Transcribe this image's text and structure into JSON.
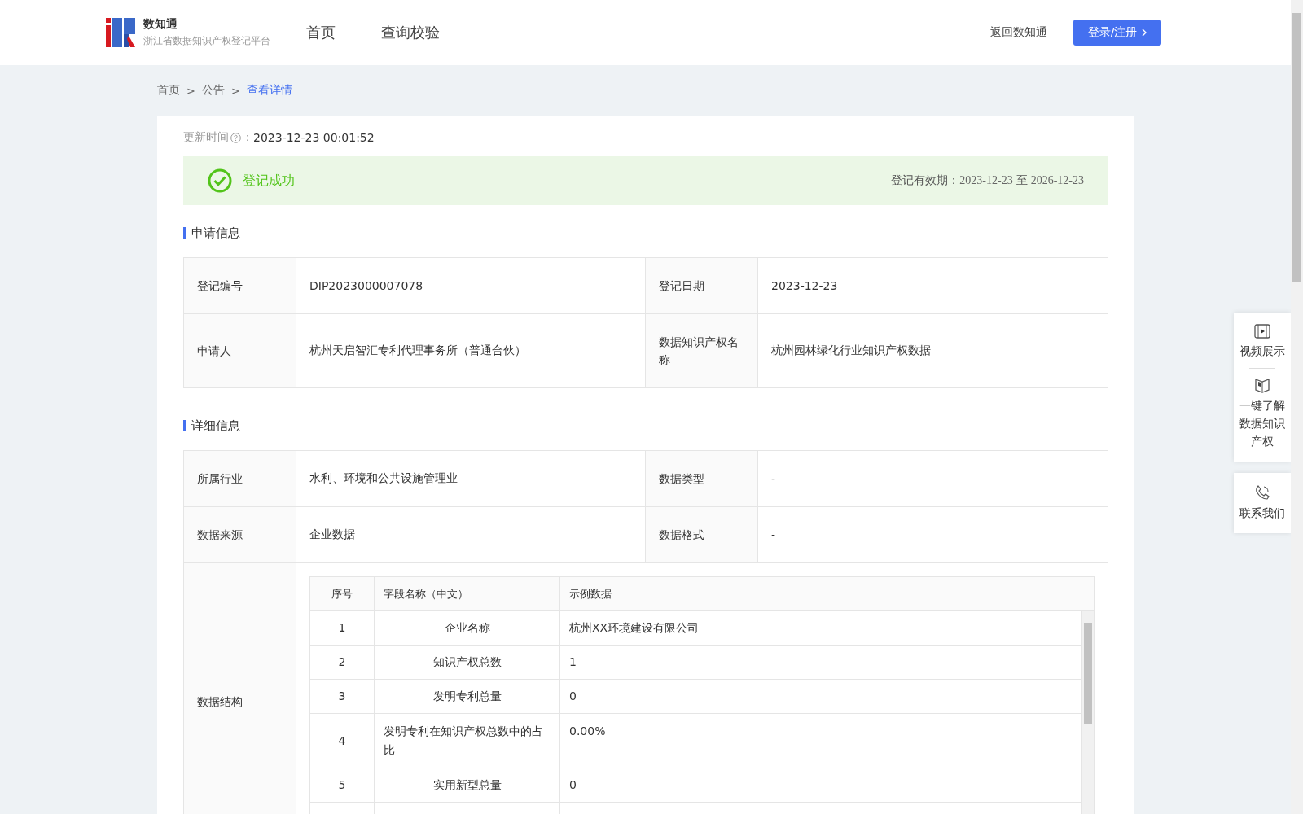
{
  "header": {
    "brand": "数知通",
    "subtitle": "浙江省数据知识产权登记平台",
    "nav": [
      {
        "label": "首页",
        "selected": false
      },
      {
        "label": "查询校验",
        "selected": false
      }
    ],
    "back_link": "返回数知通",
    "login_button": "登录/注册"
  },
  "breadcrumb": [
    {
      "label": "首页",
      "selected": false
    },
    {
      "label": "公告",
      "selected": false
    },
    {
      "label": "查看详情",
      "selected": true
    }
  ],
  "breadcrumb_separator": ">",
  "update": {
    "label": "更新时间",
    "separator": "：",
    "value": "2023-12-23 00:01:52"
  },
  "status": {
    "text": "登记成功",
    "validity_label": "登记有效期：",
    "start": "2023-12-23",
    "to": "至",
    "end": "2026-12-23"
  },
  "application": {
    "title": "申请信息",
    "rows": [
      {
        "label1": "登记编号",
        "value1": "DIP2023000007078",
        "label2": "登记日期",
        "value2": "2023-12-23"
      },
      {
        "label1": "申请人",
        "value1": "杭州天启智汇专利代理事务所（普通合伙）",
        "label2": "数据知识产权名称",
        "value2": "杭州园林绿化行业知识产权数据"
      }
    ]
  },
  "details": {
    "title": "详细信息",
    "rows": [
      {
        "label1": "所属行业",
        "value1": "水利、环境和公共设施管理业",
        "label2": "数据类型",
        "value2": "-"
      },
      {
        "label1": "数据来源",
        "value1": "企业数据",
        "label2": "数据格式",
        "value2": "-"
      }
    ],
    "structure_label": "数据结构",
    "structure_table": {
      "columns": [
        "序号",
        "字段名称（中文）",
        "示例数据"
      ],
      "rows": [
        [
          "1",
          "企业名称",
          "杭州XX环境建设有限公司"
        ],
        [
          "2",
          "知识产权总数",
          "1"
        ],
        [
          "3",
          "发明专利总量",
          "0"
        ],
        [
          "4",
          "发明专利在知识产权总数中的占比",
          "0.00%"
        ],
        [
          "5",
          "实用新型总量",
          "0"
        ]
      ]
    }
  },
  "side_panel": [
    {
      "kind": "video",
      "label": "视频展示"
    },
    {
      "kind": "book",
      "label": "一键了解数据知识产权"
    },
    {
      "kind": "phone",
      "label": "联系我们"
    }
  ]
}
